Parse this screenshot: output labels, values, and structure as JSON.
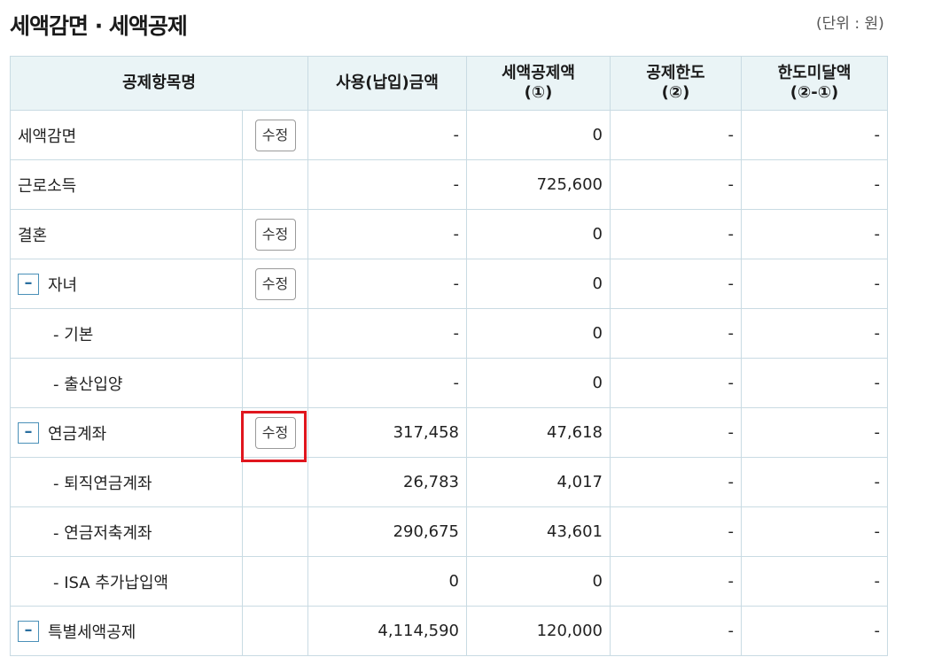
{
  "page": {
    "title": "세액감면 · 세액공제",
    "unit": "(단위 : 원)"
  },
  "table": {
    "headers": {
      "item": "공제항목명",
      "amount": "사용(납입)금액",
      "deduction_line1": "세액공제액",
      "deduction_line2": "(①)",
      "limit_line1": "공제한도",
      "limit_line2": "(②)",
      "remaining_line1": "한도미달액",
      "remaining_line2": "(②-①)"
    },
    "edit_label": "수정",
    "collapse_symbol": "–",
    "rows": [
      {
        "label": "세액감면",
        "amount": "-",
        "deduction": "0",
        "limit": "-",
        "remaining": "-"
      },
      {
        "label": "근로소득",
        "amount": "-",
        "deduction": "725,600",
        "limit": "-",
        "remaining": "-"
      },
      {
        "label": "결혼",
        "amount": "-",
        "deduction": "0",
        "limit": "-",
        "remaining": "-"
      },
      {
        "label": "자녀",
        "amount": "-",
        "deduction": "0",
        "limit": "-",
        "remaining": "-"
      },
      {
        "label": "- 기본",
        "amount": "-",
        "deduction": "0",
        "limit": "-",
        "remaining": "-"
      },
      {
        "label": "- 출산입양",
        "amount": "-",
        "deduction": "0",
        "limit": "-",
        "remaining": "-"
      },
      {
        "label": "연금계좌",
        "amount": "317,458",
        "deduction": "47,618",
        "limit": "-",
        "remaining": "-"
      },
      {
        "label": "- 퇴직연금계좌",
        "amount": "26,783",
        "deduction": "4,017",
        "limit": "-",
        "remaining": "-"
      },
      {
        "label": "- 연금저축계좌",
        "amount": "290,675",
        "deduction": "43,601",
        "limit": "-",
        "remaining": "-"
      },
      {
        "label": "- ISA 추가납입액",
        "amount": "0",
        "deduction": "0",
        "limit": "-",
        "remaining": "-"
      },
      {
        "label": "특별세액공제",
        "amount": "4,114,590",
        "deduction": "120,000",
        "limit": "-",
        "remaining": "-"
      }
    ]
  },
  "colors": {
    "header_bg": "#eaf4f6",
    "border": "#c9dbe3",
    "toggle_blue": "#2a6fa0",
    "highlight_red": "#e0161e"
  }
}
